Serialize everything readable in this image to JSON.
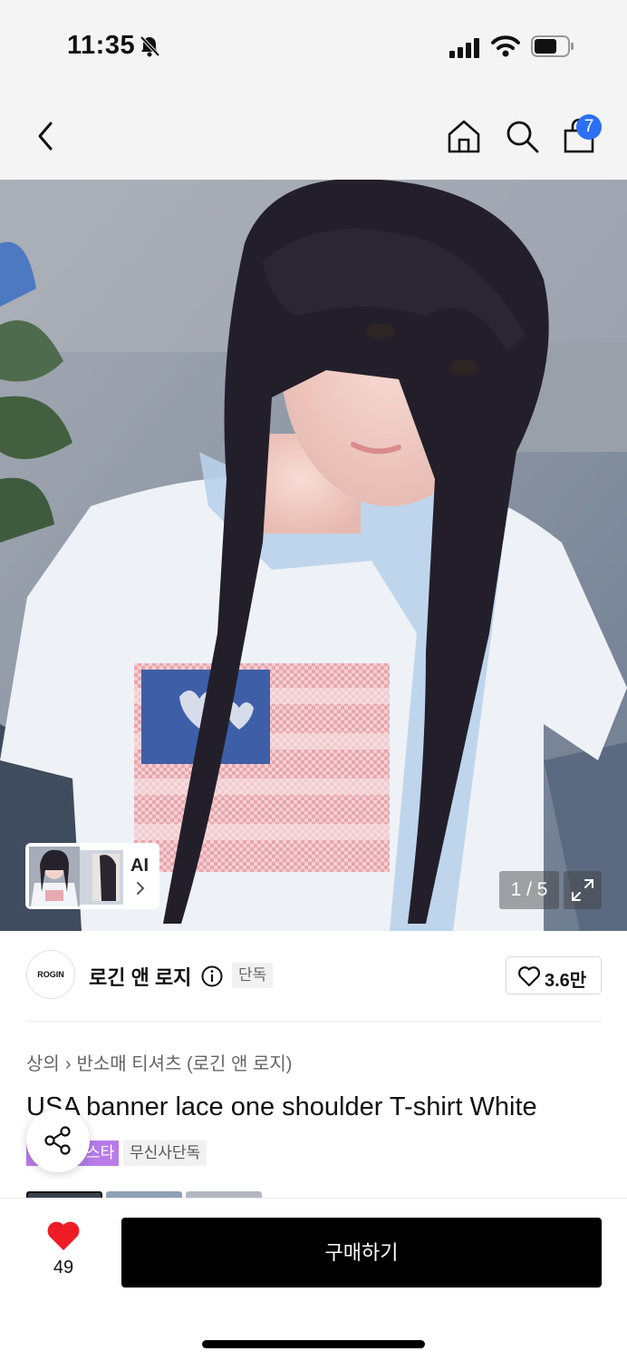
{
  "status_bar": {
    "time": "11:35"
  },
  "nav": {
    "cart_count": "7"
  },
  "gallery": {
    "ai_label": "AI",
    "counter": "1 / 5",
    "current_index": 1,
    "total": 5
  },
  "brand": {
    "logo_text": "ROGIN",
    "name": "로긴 앤 로지",
    "tag": "단독",
    "like_count": "3.6만"
  },
  "breadcrumb": [
    "상의",
    "반소매 티셔츠 (로긴 앤 로지)"
  ],
  "product": {
    "title": "USA banner lace one shoulder T-shirt White",
    "badges": [
      {
        "text": "스타",
        "color": "#b77ce8"
      },
      {
        "text": "무신사단독",
        "color": "#f1f1f1"
      }
    ]
  },
  "bottom": {
    "wishlist_count": "49",
    "buy_label": "구매하기"
  },
  "colors": {
    "accent": "#2b6ff6",
    "heart": "#ee1c25",
    "buy_button": "#000000"
  },
  "icons": [
    "bell-off-icon",
    "signal-icon",
    "wifi-icon",
    "battery-icon",
    "back-icon",
    "home-icon",
    "search-icon",
    "bag-icon",
    "chevron-right-icon",
    "expand-icon",
    "info-icon",
    "heart-outline-icon",
    "share-icon",
    "heart-filled-icon"
  ]
}
